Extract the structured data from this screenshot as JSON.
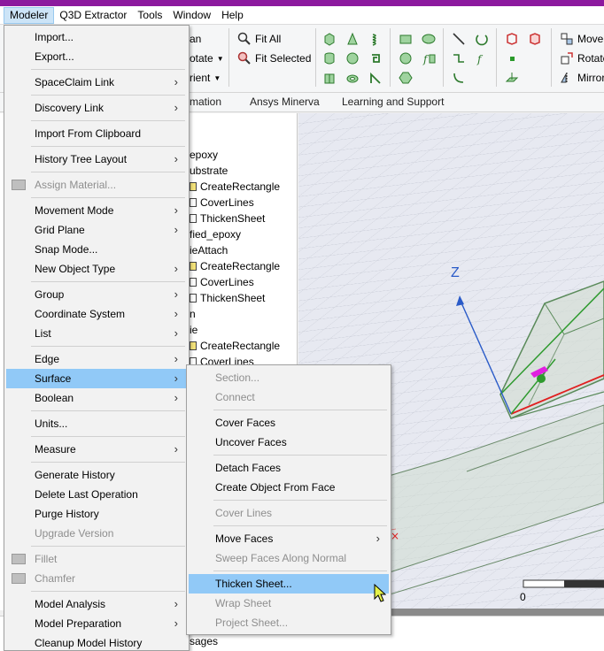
{
  "menubar": {
    "items": [
      "Modeler",
      "Q3D Extractor",
      "Tools",
      "Window",
      "Help"
    ],
    "active": "Modeler"
  },
  "ribbon": {
    "fit_all": "Fit All",
    "fit_selected": "Fit Selected",
    "partial_left": [
      "an",
      "otate",
      "rient"
    ],
    "move": "Move",
    "rotate": "Rotate",
    "mirror": "Mirror",
    "tabs": [
      "mation",
      "Ansys Minerva",
      "Learning and Support"
    ]
  },
  "tree": {
    "nodes": [
      {
        "label": "epoxy",
        "icon": "none"
      },
      {
        "label": "ubstrate",
        "icon": "none"
      },
      {
        "label": "CreateRectangle",
        "icon": "yellow"
      },
      {
        "label": "CoverLines",
        "icon": "white"
      },
      {
        "label": "ThickenSheet",
        "icon": "white"
      },
      {
        "label": "fied_epoxy",
        "icon": "none"
      },
      {
        "label": "ieAttach",
        "icon": "none"
      },
      {
        "label": "CreateRectangle",
        "icon": "yellow"
      },
      {
        "label": "CoverLines",
        "icon": "white"
      },
      {
        "label": "ThickenSheet",
        "icon": "white"
      },
      {
        "label": "n",
        "icon": "none"
      },
      {
        "label": "ie",
        "icon": "none"
      },
      {
        "label": "CreateRectangle",
        "icon": "yellow"
      },
      {
        "label": "CoverLines",
        "icon": "white"
      }
    ]
  },
  "viewport": {
    "axis_label": "Z",
    "scale_zero": "0"
  },
  "messages_label": "sages",
  "modeler_menu": [
    {
      "label": "Import...",
      "arrow": false,
      "disabled": false
    },
    {
      "label": "Export...",
      "arrow": false,
      "disabled": false
    },
    {
      "sep": true
    },
    {
      "label": "SpaceClaim Link",
      "arrow": true,
      "disabled": false
    },
    {
      "sep": true
    },
    {
      "label": "Discovery Link",
      "arrow": true,
      "disabled": false
    },
    {
      "sep": true
    },
    {
      "label": "Import From Clipboard",
      "arrow": false,
      "disabled": false
    },
    {
      "sep": true
    },
    {
      "label": "History Tree Layout",
      "arrow": true,
      "disabled": false
    },
    {
      "sep": true
    },
    {
      "label": "Assign Material...",
      "arrow": false,
      "disabled": true,
      "icon": "material-icon"
    },
    {
      "sep": true
    },
    {
      "label": "Movement Mode",
      "arrow": true,
      "disabled": false
    },
    {
      "label": "Grid Plane",
      "arrow": true,
      "disabled": false
    },
    {
      "label": "Snap Mode...",
      "arrow": false,
      "disabled": false
    },
    {
      "label": "New Object Type",
      "arrow": true,
      "disabled": false
    },
    {
      "sep": true
    },
    {
      "label": "Group",
      "arrow": true,
      "disabled": false
    },
    {
      "label": "Coordinate System",
      "arrow": true,
      "disabled": false
    },
    {
      "label": "List",
      "arrow": true,
      "disabled": false
    },
    {
      "sep": true
    },
    {
      "label": "Edge",
      "arrow": true,
      "disabled": false
    },
    {
      "label": "Surface",
      "arrow": true,
      "disabled": false,
      "highlight": true
    },
    {
      "label": "Boolean",
      "arrow": true,
      "disabled": false
    },
    {
      "sep": true
    },
    {
      "label": "Units...",
      "arrow": false,
      "disabled": false
    },
    {
      "sep": true
    },
    {
      "label": "Measure",
      "arrow": true,
      "disabled": false
    },
    {
      "sep": true
    },
    {
      "label": "Generate History",
      "arrow": false,
      "disabled": false
    },
    {
      "label": "Delete Last Operation",
      "arrow": false,
      "disabled": false
    },
    {
      "label": "Purge History",
      "arrow": false,
      "disabled": false
    },
    {
      "label": "Upgrade Version",
      "arrow": false,
      "disabled": true
    },
    {
      "sep": true
    },
    {
      "label": "Fillet",
      "arrow": false,
      "disabled": true,
      "icon": "fillet-icon"
    },
    {
      "label": "Chamfer",
      "arrow": false,
      "disabled": true,
      "icon": "chamfer-icon"
    },
    {
      "sep": true
    },
    {
      "label": "Model Analysis",
      "arrow": true,
      "disabled": false
    },
    {
      "label": "Model Preparation",
      "arrow": true,
      "disabled": false
    },
    {
      "label": "Cleanup Model History",
      "arrow": false,
      "disabled": false
    }
  ],
  "surface_menu": [
    {
      "label": "Section...",
      "arrow": false,
      "disabled": true
    },
    {
      "label": "Connect",
      "arrow": false,
      "disabled": true
    },
    {
      "sep": true
    },
    {
      "label": "Cover Faces",
      "arrow": false,
      "disabled": false
    },
    {
      "label": "Uncover Faces",
      "arrow": false,
      "disabled": false
    },
    {
      "sep": true
    },
    {
      "label": "Detach Faces",
      "arrow": false,
      "disabled": false
    },
    {
      "label": "Create Object From Face",
      "arrow": false,
      "disabled": false
    },
    {
      "sep": true
    },
    {
      "label": "Cover Lines",
      "arrow": false,
      "disabled": true
    },
    {
      "sep": true
    },
    {
      "label": "Move Faces",
      "arrow": true,
      "disabled": false
    },
    {
      "label": "Sweep Faces Along Normal",
      "arrow": false,
      "disabled": true
    },
    {
      "sep": true
    },
    {
      "label": "Thicken Sheet...",
      "arrow": false,
      "disabled": false,
      "highlight": true
    },
    {
      "label": "Wrap Sheet",
      "arrow": false,
      "disabled": true
    },
    {
      "label": "Project Sheet...",
      "arrow": false,
      "disabled": true
    }
  ]
}
